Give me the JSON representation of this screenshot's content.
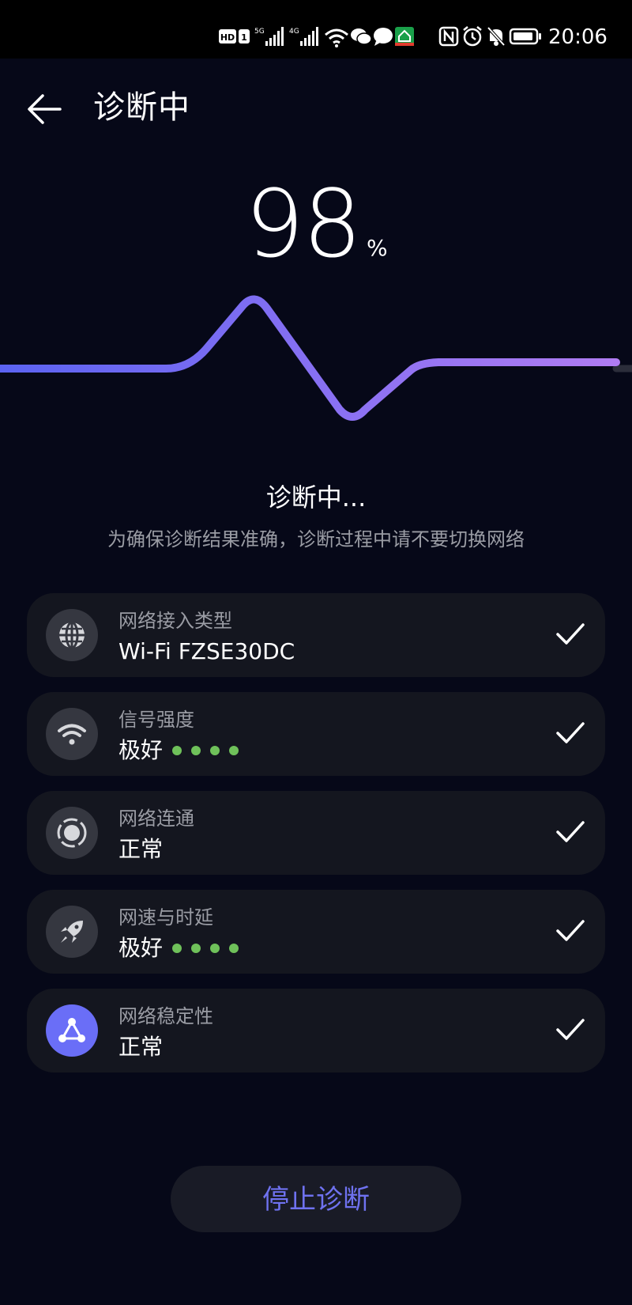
{
  "status_bar": {
    "time": "20:06",
    "hd_badge": "HD",
    "sim_slot": "1",
    "network_5g": "5G",
    "network_4g": "4G"
  },
  "header": {
    "title": "诊断中"
  },
  "progress": {
    "value": "98",
    "unit": "%",
    "percent": 98
  },
  "status": {
    "text": "诊断中...",
    "hint": "为确保诊断结果准确，诊断过程中请不要切换网络"
  },
  "items": [
    {
      "label": "网络接入类型",
      "value": "Wi-Fi FZSE30DC",
      "icon": "globe-icon",
      "dots": 0
    },
    {
      "label": "信号强度",
      "value": "极好",
      "icon": "wifi-icon",
      "dots": 4
    },
    {
      "label": "网络连通",
      "value": "正常",
      "icon": "connectivity-icon",
      "dots": 0
    },
    {
      "label": "网速与时延",
      "value": "极好",
      "icon": "rocket-icon",
      "dots": 4
    },
    {
      "label": "网络稳定性",
      "value": "正常",
      "icon": "stability-icon",
      "dots": 0
    }
  ],
  "actions": {
    "stop_label": "停止诊断"
  },
  "colors": {
    "accent": "#6a6ef7",
    "wave_start": "#5b63f2",
    "wave_end": "#b07cf3",
    "good": "#6fc15a",
    "background": "#060818"
  }
}
